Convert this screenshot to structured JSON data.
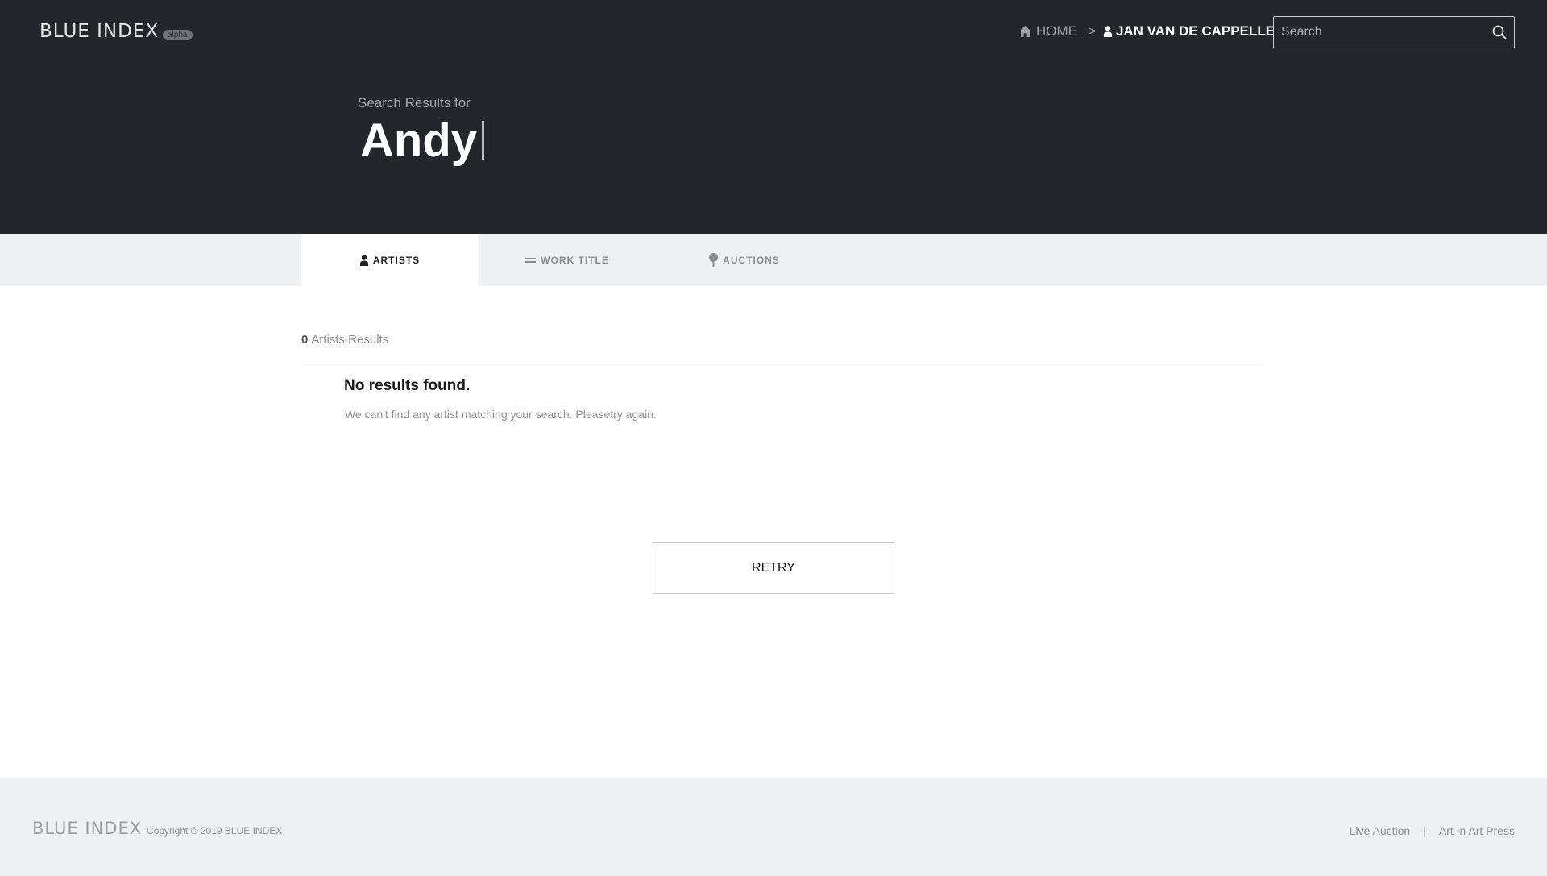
{
  "brand": {
    "name": "BLUE INDEX",
    "badge": "alpha"
  },
  "breadcrumb": {
    "home": "HOME",
    "separator": ">",
    "current": "JAN VAN DE CAPPELLE"
  },
  "search": {
    "placeholder": "Search",
    "value": ""
  },
  "hero": {
    "label": "Search Results for",
    "query": "Andy"
  },
  "tabs": [
    {
      "label": "ARTISTS",
      "icon": "person-icon",
      "active": true
    },
    {
      "label": "WORK TITLE",
      "icon": "lines-icon",
      "active": false
    },
    {
      "label": "AUCTIONS",
      "icon": "pin-icon",
      "active": false
    }
  ],
  "results": {
    "count": "0",
    "count_label": "Artists Results",
    "empty_title": "No results found.",
    "empty_message": "We can't find any artist matching your search. Pleasetry again.",
    "retry_label": "RETRY"
  },
  "footer": {
    "logo": "BLUE INDEX",
    "copyright": "Copyright © 2019 BLUE INDEX",
    "links": [
      "Live Auction",
      "Art In Art Press"
    ],
    "separator": "|"
  },
  "colors": {
    "header_bg": "#23272b",
    "tabbar_bg": "#edf1f4",
    "footer_bg": "#edf1f4"
  }
}
